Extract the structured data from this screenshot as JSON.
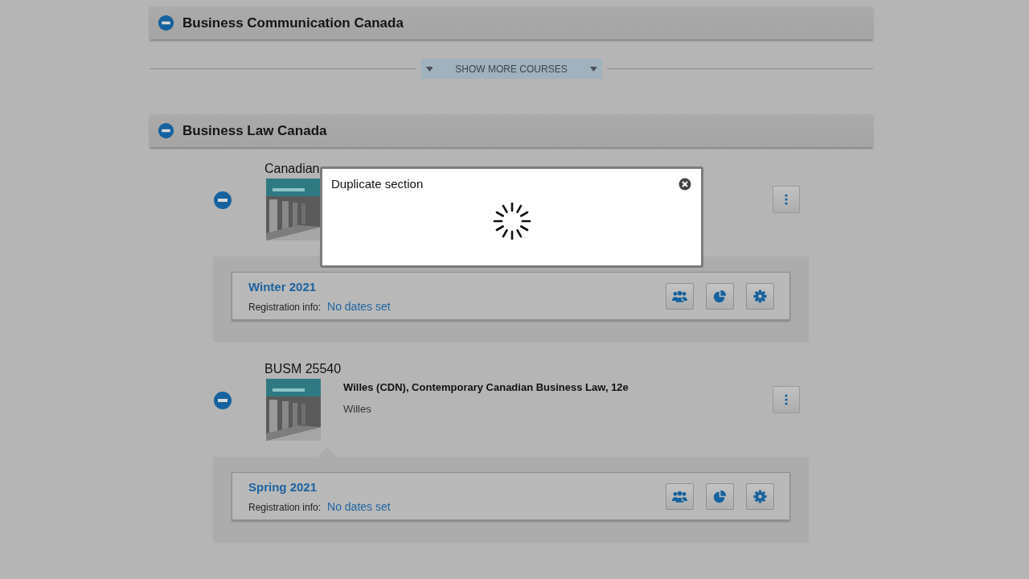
{
  "groups": [
    {
      "title": "Business Communication Canada",
      "expanded": true
    },
    {
      "title": "Business Law Canada",
      "expanded": true,
      "courses": [
        {
          "code": "Canadian",
          "expanded": true,
          "book": {
            "kind": "picture"
          },
          "sections": [
            {
              "term": "Winter 2021",
              "registration_label": "Registration info:",
              "registration_value": "No dates set"
            }
          ]
        },
        {
          "code": "BUSM 25540",
          "expanded": true,
          "book": {
            "kind": "picture",
            "title": "Willes (CDN), Contemporary Canadian Business Law, 12e",
            "author": "Willes"
          },
          "sections": [
            {
              "term": "Spring 2021",
              "registration_label": "Registration info:",
              "registration_value": "No dates set"
            }
          ]
        }
      ]
    }
  ],
  "show_more": {
    "label": "SHOW MORE COURSES"
  },
  "dialog": {
    "title": "Duplicate section",
    "loading": true
  }
}
